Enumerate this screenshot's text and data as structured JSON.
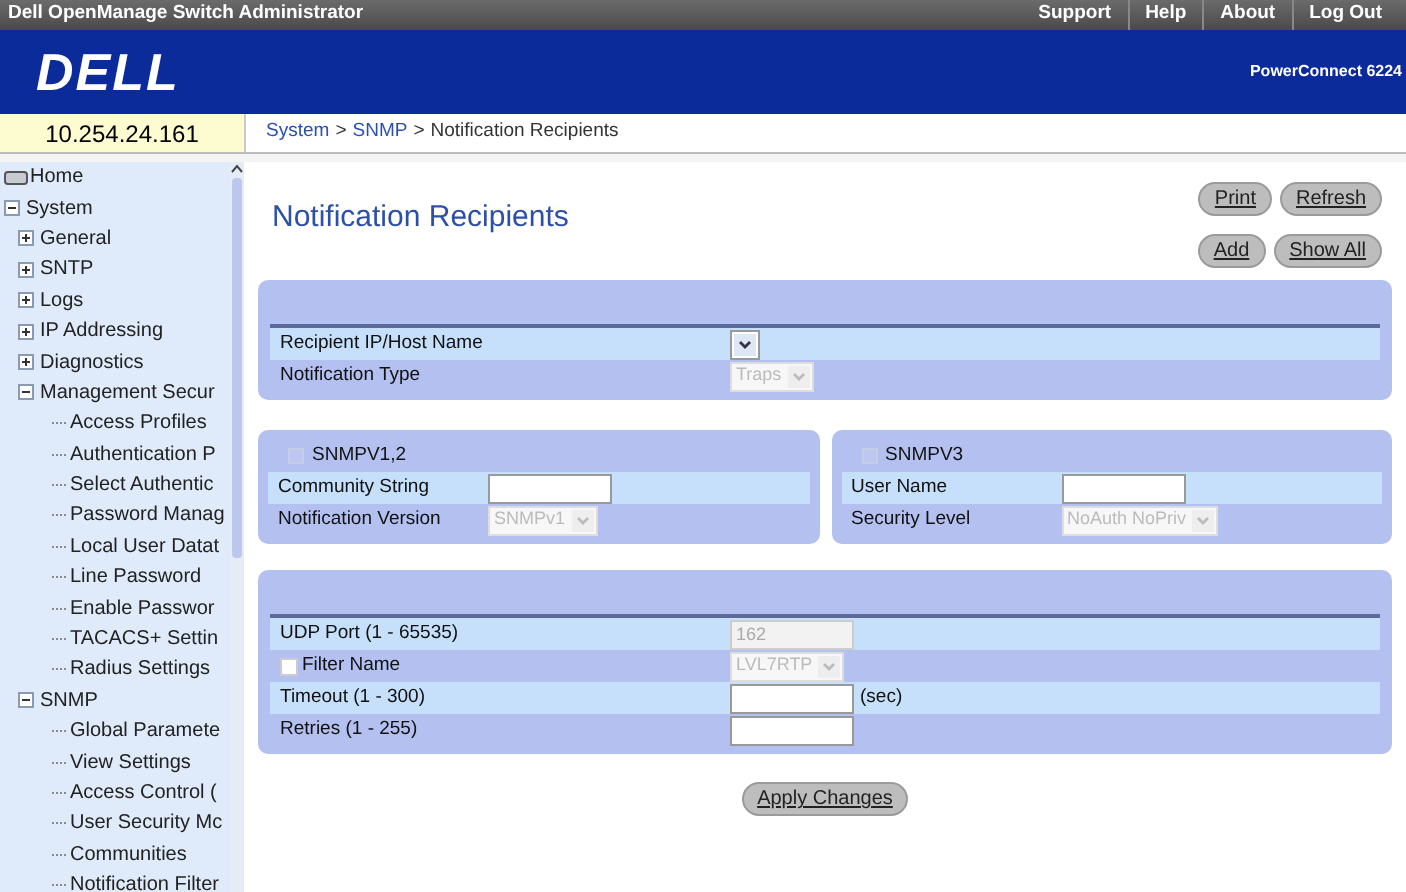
{
  "title_bar": {
    "title": "Dell OpenManage Switch Administrator",
    "links": [
      "Support",
      "Help",
      "About",
      "Log Out"
    ]
  },
  "banner": {
    "logo": "DELL",
    "model": "PowerConnect 6224"
  },
  "ip_address": "10.254.24.161",
  "breadcrumb": [
    {
      "kind": "link",
      "label": "System"
    },
    {
      "kind": "separator",
      "label": ">"
    },
    {
      "kind": "link",
      "label": "SNMP"
    },
    {
      "kind": "separator",
      "label": ">"
    },
    {
      "kind": "current",
      "label": "Notification Recipients"
    }
  ],
  "sidebar": {
    "items": [
      {
        "label": "Home",
        "kind": "home"
      },
      {
        "label": "System",
        "kind": "folder",
        "expanded": true,
        "children": [
          {
            "label": "General",
            "kind": "folder",
            "expanded": false
          },
          {
            "label": "SNTP",
            "kind": "folder",
            "expanded": false
          },
          {
            "label": "Logs",
            "kind": "folder",
            "expanded": false
          },
          {
            "label": "IP Addressing",
            "kind": "folder",
            "expanded": false
          },
          {
            "label": "Diagnostics",
            "kind": "folder",
            "expanded": false
          },
          {
            "label": "Management Secur",
            "kind": "folder",
            "expanded": true,
            "children": [
              {
                "label": "Access Profiles",
                "kind": "leaf"
              },
              {
                "label": "Authentication P",
                "kind": "leaf"
              },
              {
                "label": "Select Authentic",
                "kind": "leaf"
              },
              {
                "label": "Password Manag",
                "kind": "leaf"
              },
              {
                "label": "Local User Datat",
                "kind": "leaf"
              },
              {
                "label": "Line Password",
                "kind": "leaf"
              },
              {
                "label": "Enable Passwor",
                "kind": "leaf"
              },
              {
                "label": "TACACS+ Settin",
                "kind": "leaf"
              },
              {
                "label": "Radius Settings",
                "kind": "leaf"
              }
            ]
          },
          {
            "label": "SNMP",
            "kind": "folder",
            "expanded": true,
            "children": [
              {
                "label": "Global Paramete",
                "kind": "leaf"
              },
              {
                "label": "View Settings",
                "kind": "leaf"
              },
              {
                "label": "Access Control (",
                "kind": "leaf"
              },
              {
                "label": "User Security Mc",
                "kind": "leaf"
              },
              {
                "label": "Communities",
                "kind": "leaf"
              },
              {
                "label": "Notification Filter",
                "kind": "leaf"
              }
            ]
          }
        ]
      }
    ]
  },
  "page": {
    "title": "Notification Recipients",
    "buttons_top": [
      "Print",
      "Refresh"
    ],
    "buttons_second": [
      "Add",
      "Show All"
    ],
    "panel_main": {
      "rows": [
        {
          "label": "Recipient IP/Host Name",
          "kind": "select",
          "disabled": false
        },
        {
          "label": "Notification Type",
          "kind": "select",
          "value": "Traps",
          "disabled": true
        }
      ]
    },
    "panel_v12": {
      "title": "SNMPV1,2",
      "checked": false,
      "rows": [
        {
          "label": "Community String",
          "kind": "input"
        },
        {
          "label": "Notification Version",
          "kind": "select",
          "value": "SNMPv1",
          "disabled": true
        }
      ]
    },
    "panel_v3": {
      "title": "SNMPV3",
      "checked": false,
      "rows": [
        {
          "label": "User Name",
          "kind": "input"
        },
        {
          "label": "Security Level",
          "kind": "select",
          "value": "NoAuth NoPriv",
          "disabled": true
        }
      ]
    },
    "panel_options": {
      "rows": [
        {
          "label": "UDP Port (1 - 65535)",
          "kind": "input",
          "value": "162",
          "disabled": true
        },
        {
          "label": "Filter Name",
          "kind": "select",
          "value": "LVL7RTP",
          "disabled": true,
          "checked": false
        },
        {
          "label": "Timeout (1 - 300)",
          "kind": "input",
          "unit": "(sec)"
        },
        {
          "label": "Retries (1 - 255)",
          "kind": "input"
        }
      ]
    },
    "apply_button": "Apply Changes"
  }
}
